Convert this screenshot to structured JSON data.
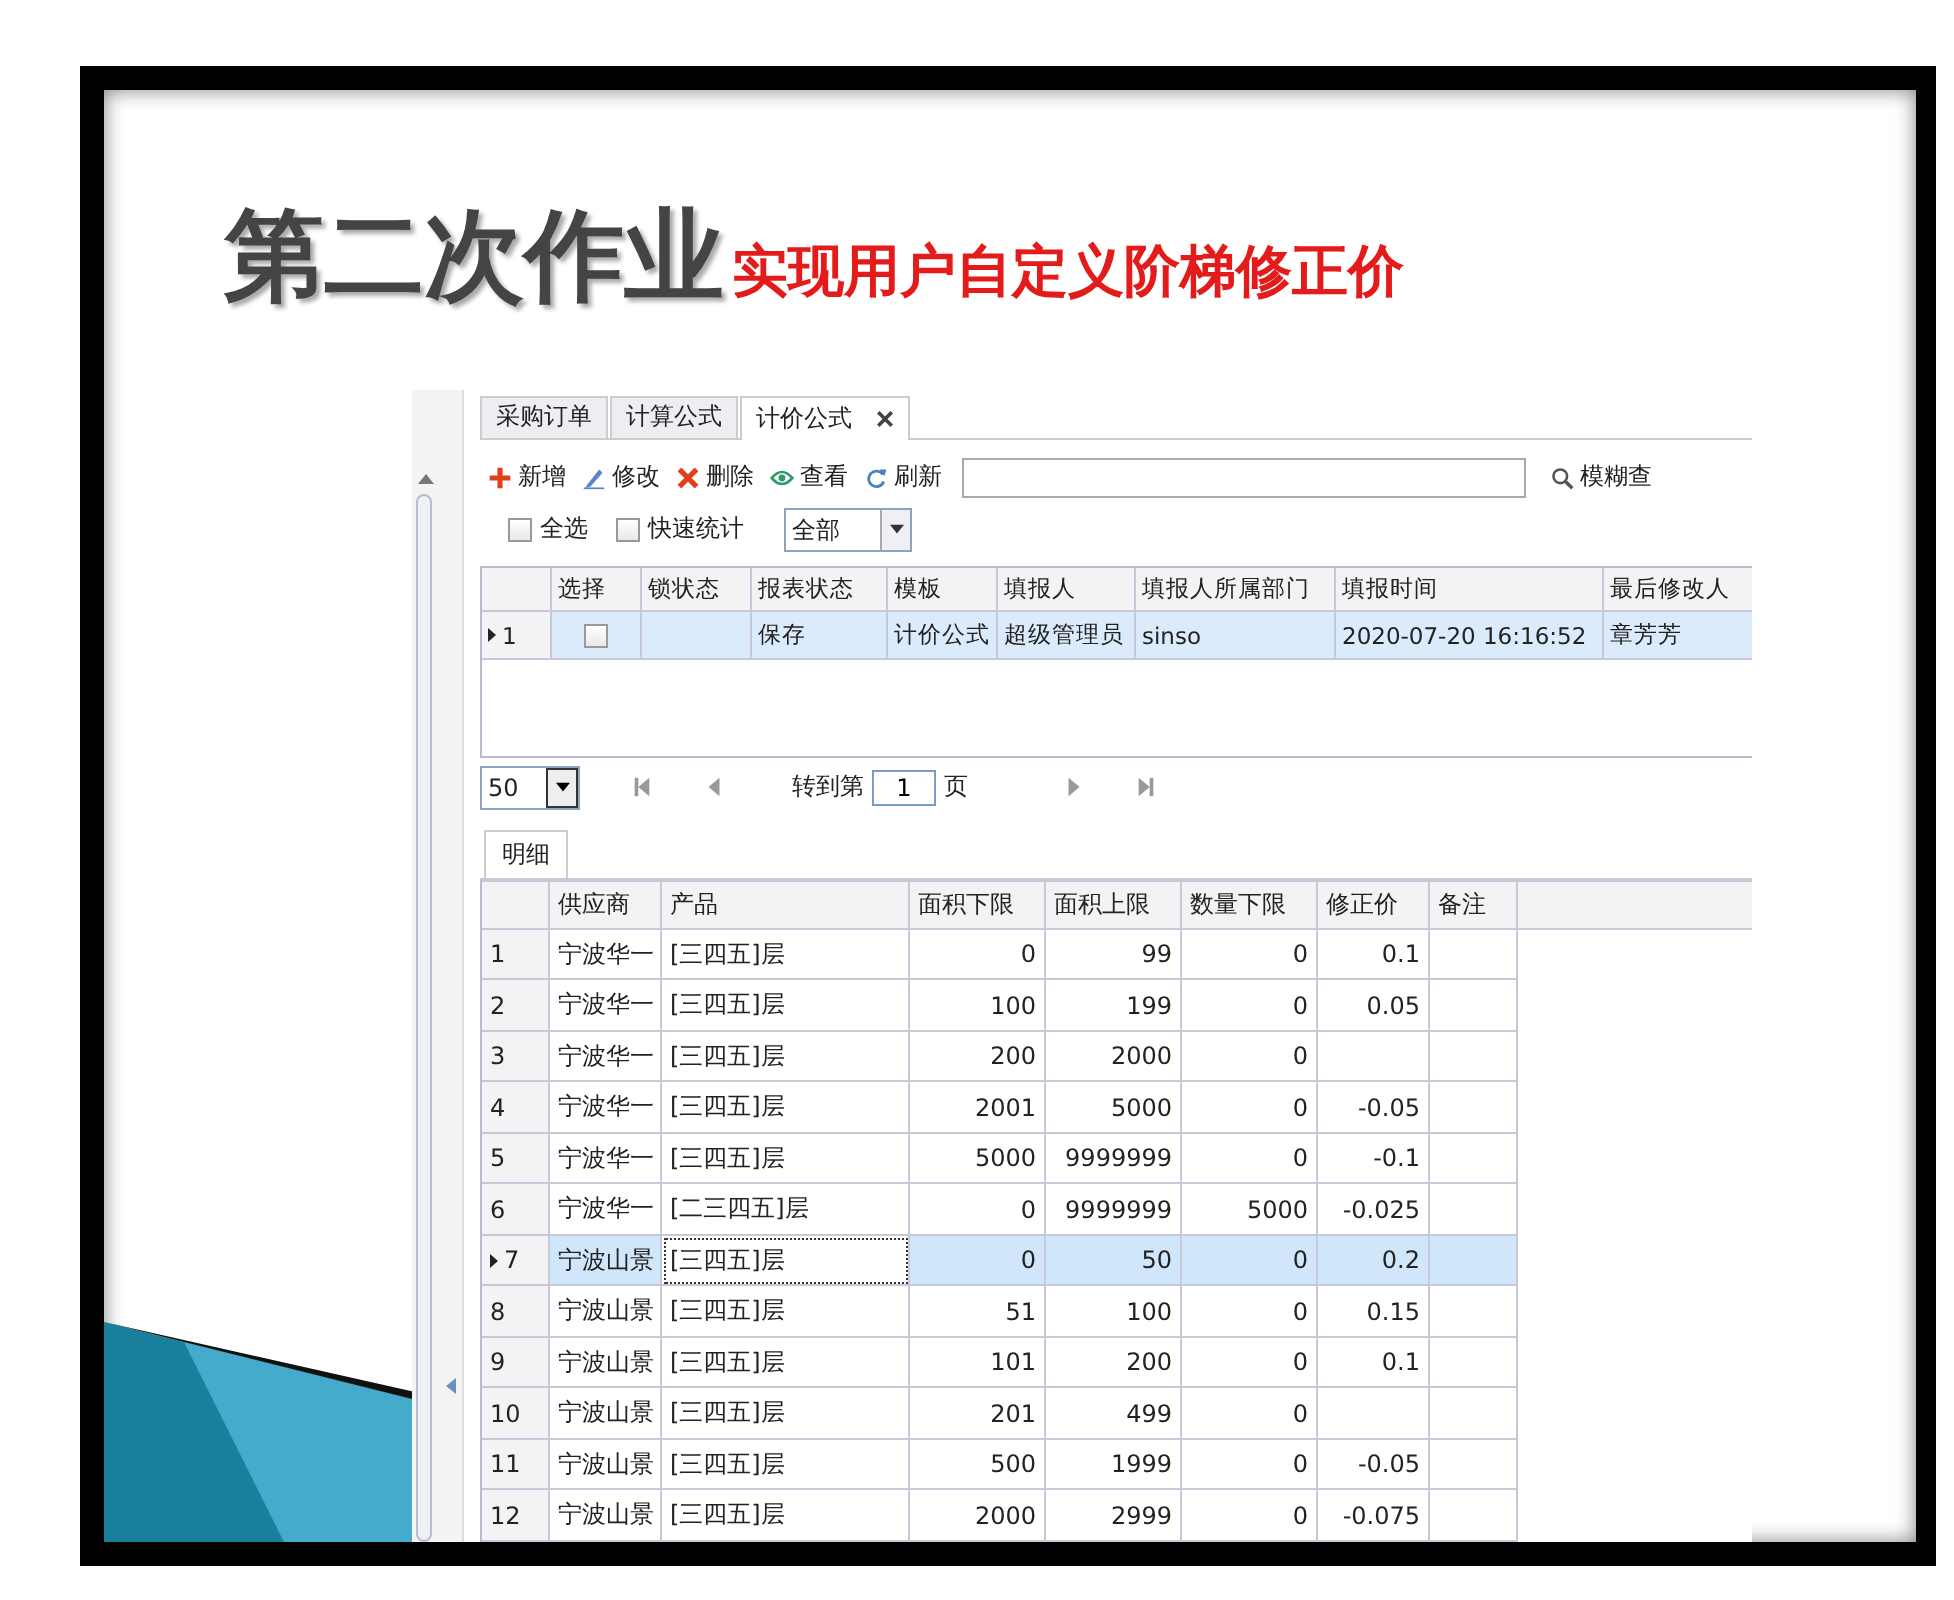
{
  "slide": {
    "title": "第二次作业",
    "subtitle": "实现用户自定义阶梯修正价"
  },
  "tabs": [
    {
      "label": "采购订单",
      "selected": false
    },
    {
      "label": "计算公式",
      "selected": false
    },
    {
      "label": "计价公式",
      "selected": true
    }
  ],
  "toolbar": [
    {
      "kind": "add",
      "label": "新增"
    },
    {
      "kind": "edit",
      "label": "修改"
    },
    {
      "kind": "delete",
      "label": "删除"
    },
    {
      "kind": "view",
      "label": "查看"
    },
    {
      "kind": "refresh",
      "label": "刷新"
    }
  ],
  "fuzzy_search": {
    "label": "模糊查"
  },
  "filters": [
    {
      "label": "全选",
      "checked": false
    },
    {
      "label": "快速统计",
      "checked": false
    }
  ],
  "filter_dropdown": {
    "value": "全部"
  },
  "master_table": {
    "columns": [
      "选择",
      "锁状态",
      "报表状态",
      "模板",
      "填报人",
      "填报人所属部门",
      "填报时间",
      "最后修改人"
    ],
    "rows": [
      {
        "number": "1",
        "current": true,
        "selected": true,
        "checked": false,
        "report_status": "保存",
        "template": "计价公式",
        "reporter": "超级管理员",
        "department": "sinso",
        "report_time": "2020-07-20 16:16:52",
        "last_modifier": "章芳芳"
      }
    ]
  },
  "pager": {
    "page_size": "50",
    "goto_label": "转到第",
    "page": "1",
    "page_unit": "页"
  },
  "detail_tab": {
    "label": "明细",
    "selected": true
  },
  "detail_table": {
    "columns": [
      "供应商",
      "产品",
      "面积下限",
      "面积上限",
      "数量下限",
      "修正价",
      "备注"
    ],
    "rows": [
      {
        "number": "1",
        "current": false,
        "selected": false,
        "focused": false,
        "cells": [
          "宁波华一",
          "[三四五]层",
          "0",
          "99",
          "0",
          "0.1"
        ]
      },
      {
        "number": "2",
        "current": false,
        "selected": false,
        "focused": false,
        "cells": [
          "宁波华一",
          "[三四五]层",
          "100",
          "199",
          "0",
          "0.05"
        ]
      },
      {
        "number": "3",
        "current": false,
        "selected": false,
        "focused": false,
        "cells": [
          "宁波华一",
          "[三四五]层",
          "200",
          "2000",
          "0"
        ]
      },
      {
        "number": "4",
        "current": false,
        "selected": false,
        "focused": false,
        "cells": [
          "宁波华一",
          "[三四五]层",
          "2001",
          "5000",
          "0",
          "-0.05"
        ]
      },
      {
        "number": "5",
        "current": false,
        "selected": false,
        "focused": false,
        "cells": [
          "宁波华一",
          "[三四五]层",
          "5000",
          "9999999",
          "0",
          "-0.1"
        ]
      },
      {
        "number": "6",
        "current": false,
        "selected": false,
        "focused": false,
        "cells": [
          "宁波华一",
          "[二三四五]层",
          "0",
          "9999999",
          "5000",
          "-0.025"
        ]
      },
      {
        "number": "7",
        "current": true,
        "selected": true,
        "focused": true,
        "cells": [
          "宁波山景",
          "[三四五]层",
          "0",
          "50",
          "0",
          "0.2"
        ]
      },
      {
        "number": "8",
        "current": false,
        "selected": false,
        "focused": false,
        "cells": [
          "宁波山景",
          "[三四五]层",
          "51",
          "100",
          "0",
          "0.15"
        ]
      },
      {
        "number": "9",
        "current": false,
        "selected": false,
        "focused": false,
        "cells": [
          "宁波山景",
          "[三四五]层",
          "101",
          "200",
          "0",
          "0.1"
        ]
      },
      {
        "number": "10",
        "current": false,
        "selected": false,
        "focused": false,
        "cells": [
          "宁波山景",
          "[三四五]层",
          "201",
          "499",
          "0"
        ]
      },
      {
        "number": "11",
        "current": false,
        "selected": false,
        "focused": false,
        "cells": [
          "宁波山景",
          "[三四五]层",
          "500",
          "1999",
          "0",
          "-0.05"
        ]
      },
      {
        "number": "12",
        "current": false,
        "selected": false,
        "focused": false,
        "cells": [
          "宁波山景",
          "[三四五]层",
          "2000",
          "2999",
          "0",
          "-0.075"
        ]
      }
    ]
  }
}
